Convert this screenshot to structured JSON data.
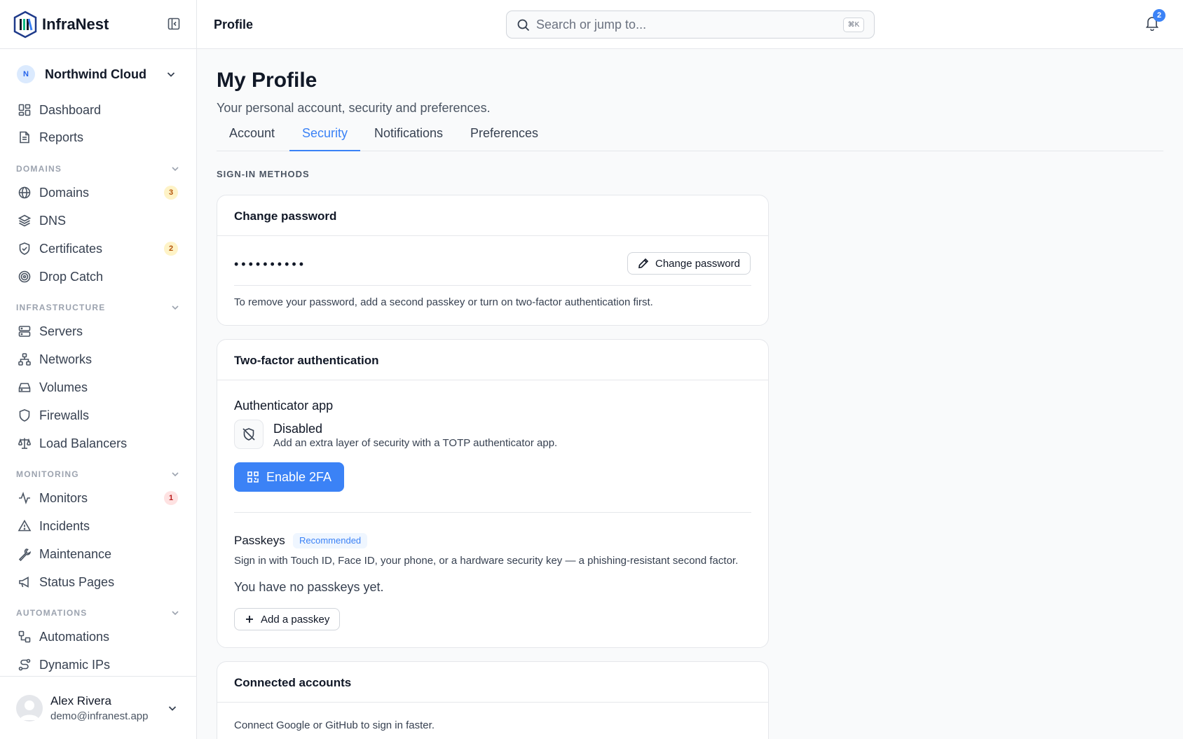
{
  "brand": {
    "name": "InfraNest"
  },
  "org": {
    "initial": "N",
    "name": "Northwind Cloud"
  },
  "nav_top": [
    {
      "label": "Dashboard",
      "icon": "dashboard-icon"
    },
    {
      "label": "Reports",
      "icon": "report-icon"
    }
  ],
  "sections": [
    {
      "title": "DOMAINS",
      "items": [
        {
          "label": "Domains",
          "icon": "globe-icon",
          "badge": "3",
          "badge_color": "#b45309"
        },
        {
          "label": "DNS",
          "icon": "layers-icon"
        },
        {
          "label": "Certificates",
          "icon": "shield-check-icon",
          "badge": "2",
          "badge_color": "#b45309"
        },
        {
          "label": "Drop Catch",
          "icon": "target-icon"
        }
      ]
    },
    {
      "title": "INFRASTRUCTURE",
      "items": [
        {
          "label": "Servers",
          "icon": "server-icon"
        },
        {
          "label": "Networks",
          "icon": "network-icon"
        },
        {
          "label": "Volumes",
          "icon": "hard-drive-icon"
        },
        {
          "label": "Firewalls",
          "icon": "shield-icon"
        },
        {
          "label": "Load Balancers",
          "icon": "scale-icon"
        }
      ]
    },
    {
      "title": "MONITORING",
      "items": [
        {
          "label": "Monitors",
          "icon": "activity-icon",
          "badge": "1",
          "badge_color": "#b91c1c"
        },
        {
          "label": "Incidents",
          "icon": "alert-triangle-icon"
        },
        {
          "label": "Maintenance",
          "icon": "wrench-icon"
        },
        {
          "label": "Status Pages",
          "icon": "megaphone-icon"
        }
      ]
    },
    {
      "title": "AUTOMATIONS",
      "items": [
        {
          "label": "Automations",
          "icon": "workflow-icon"
        },
        {
          "label": "Dynamic IPs",
          "icon": "route-icon"
        }
      ]
    }
  ],
  "user": {
    "name": "Alex Rivera",
    "email": "demo@infranest.app"
  },
  "topbar": {
    "page_title": "Profile",
    "search_placeholder": "Search or jump to...",
    "shortcut": "⌘K",
    "notifications_count": "2"
  },
  "page": {
    "title": "My Profile",
    "subtitle": "Your personal account, security and preferences.",
    "tabs": [
      {
        "label": "Account",
        "active": false
      },
      {
        "label": "Security",
        "active": true
      },
      {
        "label": "Notifications",
        "active": false
      },
      {
        "label": "Preferences",
        "active": false
      }
    ],
    "section_label": "SIGN-IN METHODS"
  },
  "password_card": {
    "title": "Change password",
    "masked_value": "••••••••••",
    "button_label": "Change password",
    "note": "To remove your password, add a second passkey or turn on two-factor authentication first."
  },
  "twofa_card": {
    "title": "Two-factor authentication",
    "app_heading": "Authenticator app",
    "status": "Disabled",
    "status_desc": "Add an extra layer of security with a TOTP authenticator app.",
    "enable_label": "Enable 2FA",
    "passkeys_heading": "Passkeys",
    "passkeys_badge": "Recommended",
    "passkeys_desc": "Sign in with Touch ID, Face ID, your phone, or a hardware security key — a phishing-resistant second factor.",
    "passkeys_empty": "You have no passkeys yet.",
    "add_passkey_label": "Add a passkey"
  },
  "connected_card": {
    "title": "Connected accounts",
    "desc": "Connect Google or GitHub to sign in faster."
  },
  "colors": {
    "accent": "#3b82f6",
    "sidebar_bg": "#ffffff",
    "page_bg": "#f9fafb"
  }
}
